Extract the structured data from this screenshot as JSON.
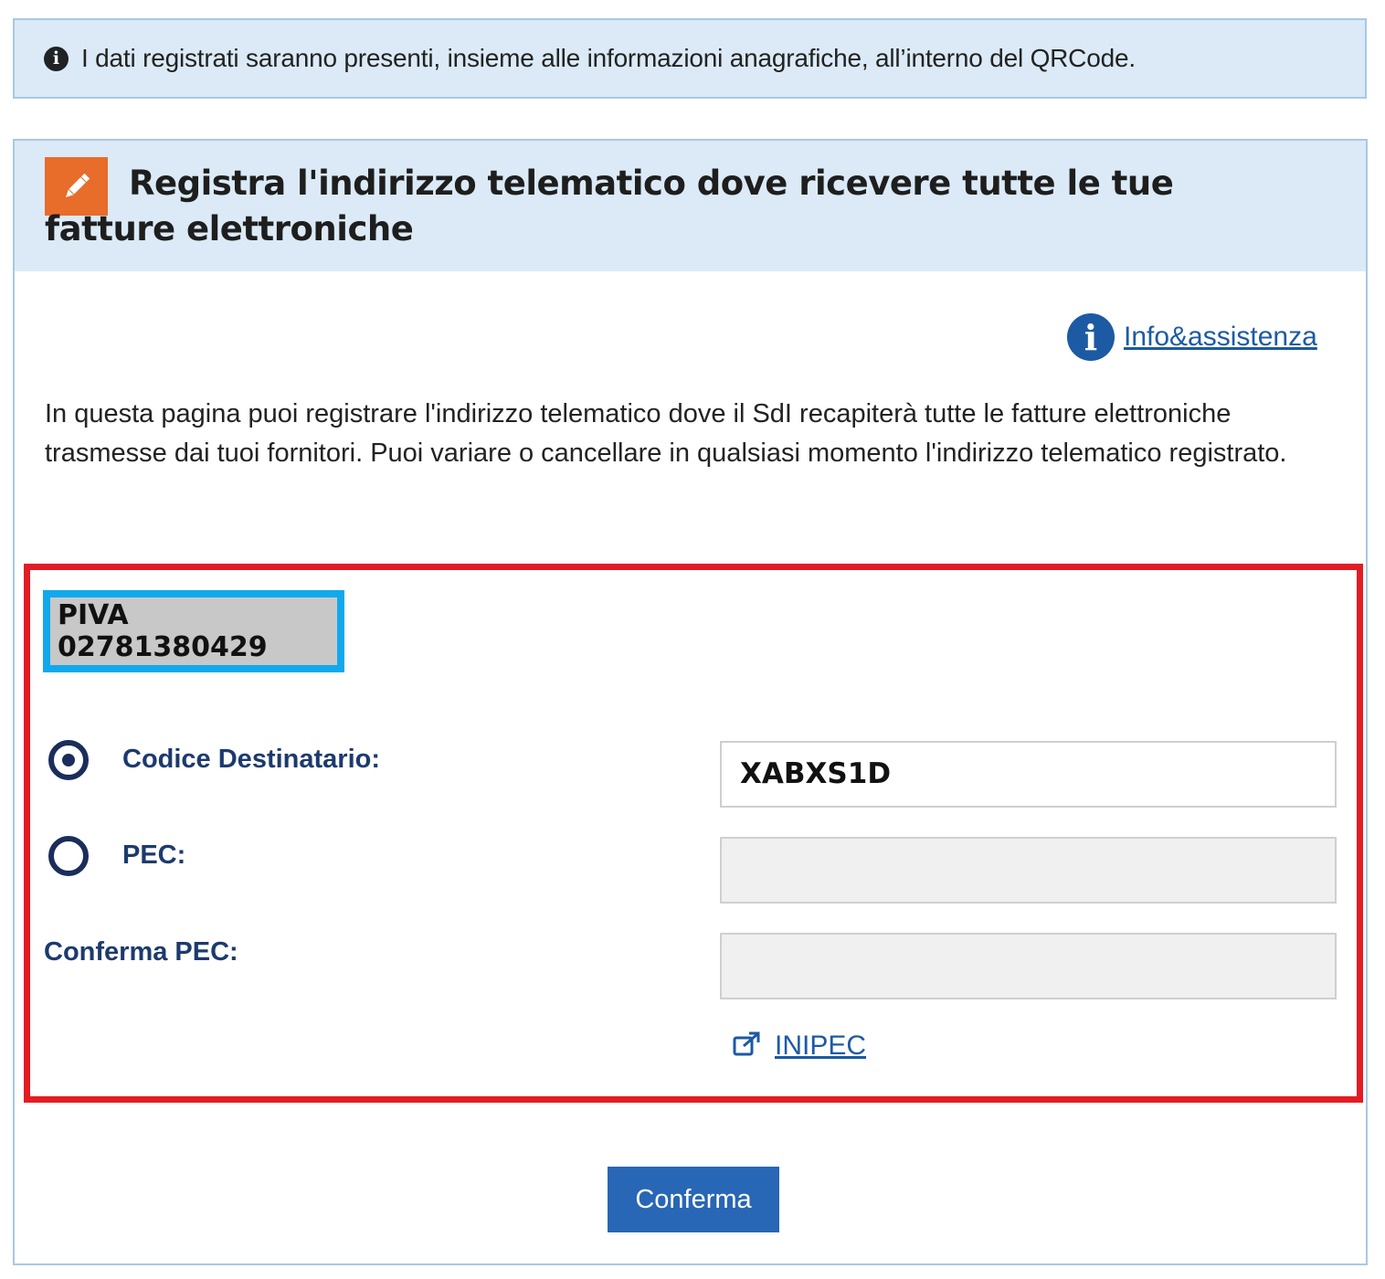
{
  "banner": {
    "icon": "info-circle-icon",
    "text": "I dati registrati saranno presenti, insieme alle informazioni anagrafiche, all’interno del QRCode."
  },
  "panel": {
    "icon": "pencil-icon",
    "icon_color": "#e86c2a",
    "title": "Registra l'indirizzo telematico dove ricevere tutte le tue fatture elettroniche",
    "info_link": {
      "icon": "info-icon",
      "label": "Info&assistenza"
    },
    "description": "In questa pagina puoi registrare l'indirizzo telematico dove il SdI recapiterà tutte le fatture elettroniche trasmesse dai tuoi fornitori. Puoi variare o cancellare in qualsiasi momento l'indirizzo telematico registrato."
  },
  "form": {
    "piva": "PIVA 02781380429",
    "codice_destinatario": {
      "label": "Codice Destinatario:",
      "value": "XABXS1D",
      "selected": true
    },
    "pec": {
      "label": "PEC:",
      "value": "",
      "selected": false
    },
    "conferma_pec": {
      "label": "Conferma PEC:",
      "value": ""
    },
    "inipec_link": {
      "icon": "external-link-icon",
      "label": "INIPEC"
    }
  },
  "actions": {
    "confirm_label": "Conferma"
  },
  "colors": {
    "banner_bg": "#dbeaf6",
    "link": "#1c5aa3",
    "label": "#1d3a6e",
    "button": "#2866b6",
    "highlight_red": "#e31c24",
    "highlight_blue": "#12a9ec"
  }
}
